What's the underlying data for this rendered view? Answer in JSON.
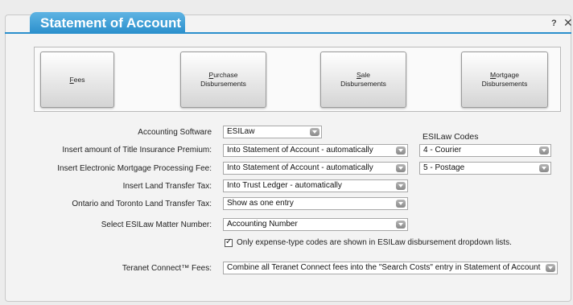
{
  "dialog": {
    "title": "Statement of Account",
    "help_label": "?",
    "close_label": "✕"
  },
  "buttons": [
    {
      "accel": "F",
      "rest": "ees",
      "line2": ""
    },
    {
      "accel": "P",
      "rest": "urchase",
      "line2": "Disbursements"
    },
    {
      "accel": "S",
      "rest": "ale",
      "line2": "Disbursements"
    },
    {
      "accel": "M",
      "rest": "ortgage",
      "line2": "Disbursements"
    }
  ],
  "form": {
    "accounting_software": {
      "label": "Accounting Software",
      "value": "ESILaw"
    },
    "title_insurance": {
      "label": "Insert amount of Title Insurance Premium:",
      "value": "Into Statement of Account - automatically"
    },
    "emp_fee": {
      "label": "Insert Electronic Mortgage Processing Fee:",
      "value": "Into Statement of Account - automatically"
    },
    "land_transfer": {
      "label": "Insert Land Transfer Tax:",
      "value": "Into Trust Ledger - automatically"
    },
    "ontario_toronto": {
      "label": "Ontario and Toronto Land Transfer Tax:",
      "value": "Show as one entry"
    },
    "matter_number": {
      "label": "Select ESILaw Matter Number:",
      "value": "Accounting Number"
    },
    "expense_only": {
      "label": "Only expense-type codes are shown in ESILaw disbursement dropdown lists.",
      "checked": true
    },
    "teranet_fees": {
      "label": "Teranet Connect™ Fees:",
      "value": "Combine all Teranet Connect fees into the \"Search Costs\" entry in Statement of Account"
    }
  },
  "esilaw_codes": {
    "heading": "ESILaw Codes",
    "code_1": "4 - Courier",
    "code_2": "5 - Postage"
  },
  "colors": {
    "accent": "#2a8fcc",
    "background": "#f3f3f3"
  }
}
